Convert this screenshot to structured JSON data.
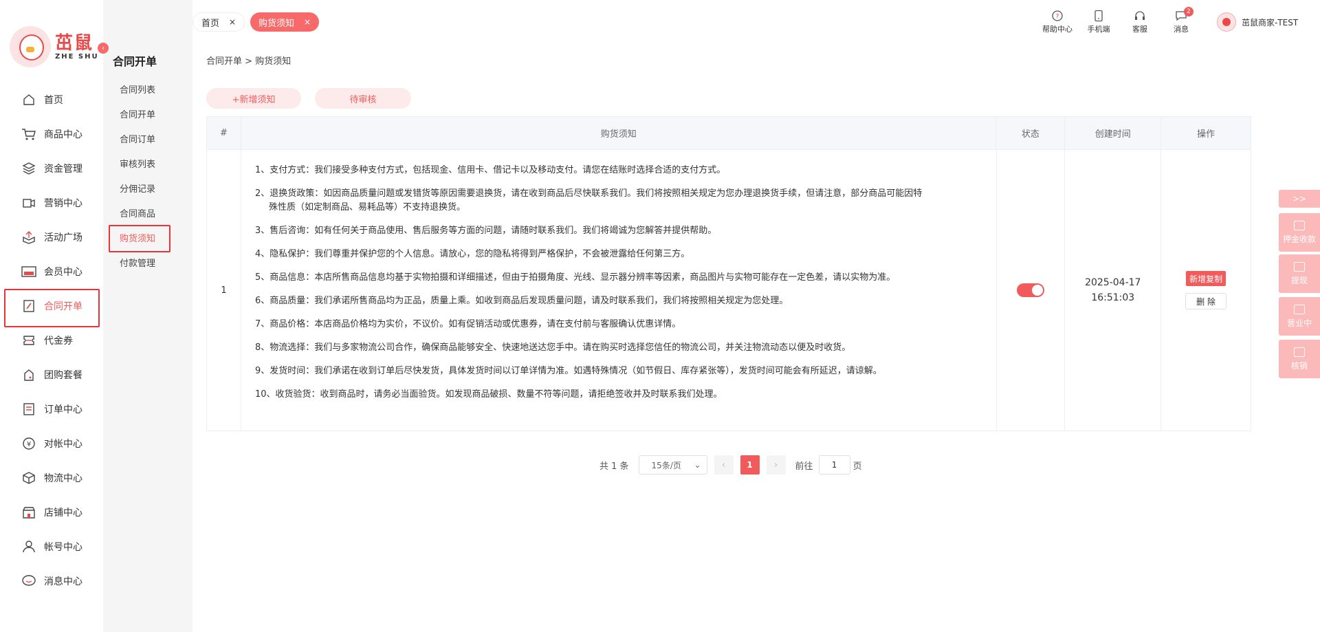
{
  "logo": {
    "cn": "茁鼠",
    "en": "ZHE SHU"
  },
  "nav": [
    {
      "label": "首页",
      "icon": "home-icon"
    },
    {
      "label": "商品中心",
      "icon": "cart-icon"
    },
    {
      "label": "资金管理",
      "icon": "layers-icon"
    },
    {
      "label": "营销中心",
      "icon": "megaphone-icon"
    },
    {
      "label": "活动广场",
      "icon": "upload-box-icon"
    },
    {
      "label": "会员中心",
      "icon": "vip-card-icon"
    },
    {
      "label": "合同开单",
      "icon": "contract-icon",
      "active": true
    },
    {
      "label": "代金券",
      "icon": "coupon-icon"
    },
    {
      "label": "团购套餐",
      "icon": "group-buy-icon"
    },
    {
      "label": "订单中心",
      "icon": "order-list-icon"
    },
    {
      "label": "对帐中心",
      "icon": "yen-icon"
    },
    {
      "label": "物流中心",
      "icon": "package-icon"
    },
    {
      "label": "店铺中心",
      "icon": "store-icon"
    },
    {
      "label": "帐号中心",
      "icon": "user-icon"
    },
    {
      "label": "消息中心",
      "icon": "message-icon"
    }
  ],
  "subnav": {
    "title": "合同开单",
    "items": [
      "合同列表",
      "合同开单",
      "合同订单",
      "审核列表",
      "分佣记录",
      "合同商品",
      "购货须知",
      "付款管理"
    ],
    "active_index": 6
  },
  "tabs": {
    "home": "首页",
    "notice": "购货须知",
    "close": "×"
  },
  "tools": {
    "help": "帮助中心",
    "mobile": "手机端",
    "service": "客服",
    "message": "消息",
    "message_badge": "2"
  },
  "user": {
    "name": "茁鼠商家-TEST"
  },
  "breadcrumb": {
    "root": "合同开单",
    "sep": " > ",
    "current": "购货须知"
  },
  "buttons": {
    "add": "+新增须知",
    "pending": "待审核"
  },
  "table": {
    "headers": [
      "#",
      "购货须知",
      "状态",
      "创建时间",
      "操作"
    ],
    "row": {
      "index": "1",
      "notices": [
        "1、支付方式：我们接受多种支付方式，包括现金、信用卡、借记卡以及移动支付。请您在结账时选择合适的支付方式。",
        "2、退换货政策：如因商品质量问题或发错货等原因需要退换货，请在收到商品后尽快联系我们。我们将按照相关规定为您办理退换货手续，但请注意，部分商品可能因特",
        "殊性质（如定制商品、易耗品等）不支持退换货。",
        "3、售后咨询：如有任何关于商品使用、售后服务等方面的问题，请随时联系我们。我们将竭诚为您解答并提供帮助。",
        "4、隐私保护：我们尊重并保护您的个人信息。请放心，您的隐私将得到严格保护，不会被泄露给任何第三方。",
        "5、商品信息：本店所售商品信息均基于实物拍摄和详细描述，但由于拍摄角度、光线、显示器分辨率等因素，商品图片与实物可能存在一定色差，请以实物为准。",
        "6、商品质量：我们承诺所售商品均为正品，质量上乘。如收到商品后发现质量问题，请及时联系我们，我们将按照相关规定为您处理。",
        "7、商品价格：本店商品价格均为实价，不议价。如有促销活动或优惠券，请在支付前与客服确认优惠详情。",
        "8、物流选择：我们与多家物流公司合作，确保商品能够安全、快速地送达您手中。请在购买时选择您信任的物流公司，并关注物流动态以便及时收货。",
        "9、发货时间：我们承诺在收到订单后尽快发货，具体发货时间以订单详情为准。如遇特殊情况（如节假日、库存紧张等），发货时间可能会有所延迟，请谅解。",
        "10、收货验货：收到商品时，请务必当面验货。如发现商品破损、数量不符等问题，请拒绝签收并及时联系我们处理。"
      ],
      "status_on": true,
      "date": "2025-04-17",
      "time": "16:51:03",
      "op_copy": "新增复制",
      "op_delete": "删 除"
    }
  },
  "pager": {
    "total": "共 1 条",
    "size": "15条/页",
    "current": "1",
    "goto_label": "前往",
    "goto_value": "1",
    "page_unit": "页"
  },
  "float": {
    "expand": ">>",
    "items": [
      "押金收款",
      "提现",
      "营业中",
      "核销"
    ]
  },
  "colors": {
    "accent": "#f25b5b",
    "accent_light": "#fdeaea",
    "float_bg": "#fbb9b9"
  }
}
